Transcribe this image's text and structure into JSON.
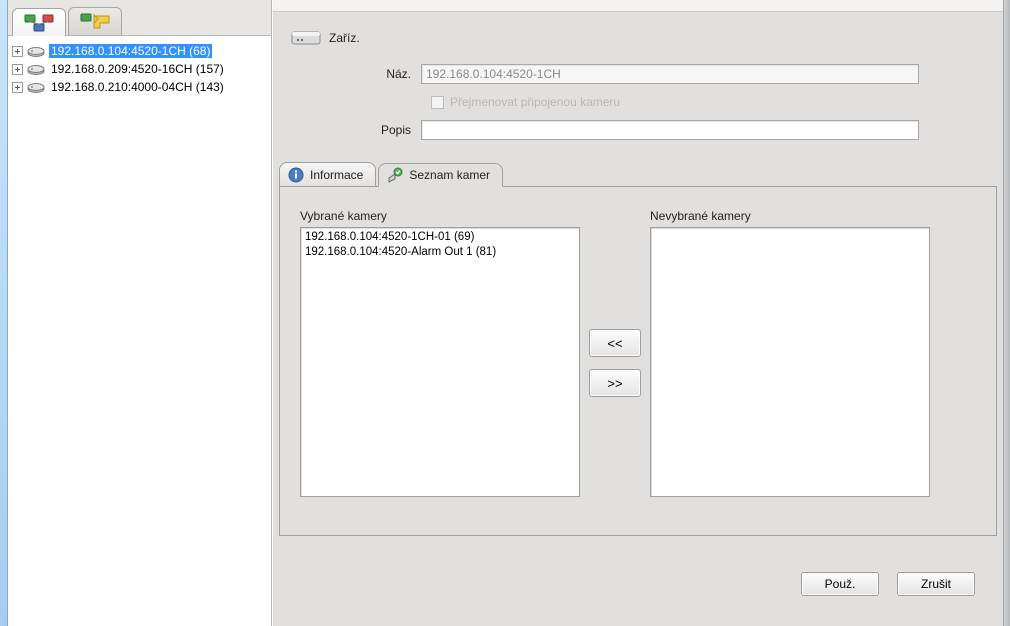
{
  "sidebar": {
    "devices": [
      {
        "label": "192.168.0.104:4520-1CH (68)"
      },
      {
        "label": "192.168.0.209:4520-16CH (157)"
      },
      {
        "label": "192.168.0.210:4000-04CH (143)"
      }
    ]
  },
  "device_panel": {
    "heading": "Zaříz.",
    "name_label": "Náz.",
    "name_value": "192.168.0.104:4520-1CH",
    "rename_label": "Přejmenovat připojenou kameru",
    "desc_label": "Popis",
    "desc_value": ""
  },
  "tabs": {
    "info": "Informace",
    "camlist": "Seznam kamer"
  },
  "cam_lists": {
    "selected_label": "Vybrané kamery",
    "unselected_label": "Nevybrané kamery",
    "selected": [
      "192.168.0.104:4520-1CH-01 (69)",
      "192.168.0.104:4520-Alarm Out 1 (81)"
    ],
    "move_left": "<<",
    "move_right": ">>"
  },
  "buttons": {
    "apply": "Použ.",
    "cancel": "Zrušit"
  }
}
